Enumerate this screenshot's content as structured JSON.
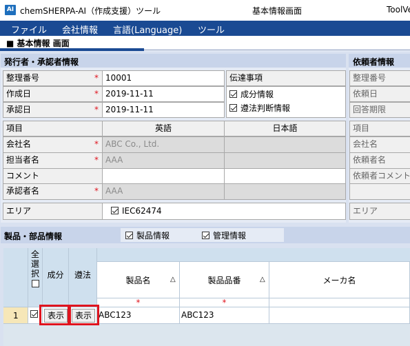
{
  "titlebar": {
    "app_icon": "AI",
    "app_title": "chemSHERPA-AI（作成支援）ツール",
    "window_center": "基本情報画面",
    "window_right": "ToolVe"
  },
  "menu": [
    "ファイル",
    "会社情報",
    "言語(Language)",
    "ツール"
  ],
  "page_header": "■ 基本情報 画面",
  "issuer": {
    "section_title": "発行者・承認者情報",
    "rows": [
      {
        "label": "整理番号",
        "value": "10001"
      },
      {
        "label": "作成日",
        "value": "2019-11-11"
      },
      {
        "label": "承認日",
        "value": "2019-11-11"
      }
    ],
    "required_mark": "*",
    "transmit": {
      "title": "伝達事項",
      "items": [
        {
          "label": "成分情報",
          "checked": true
        },
        {
          "label": "遵法判断情報",
          "checked": true
        }
      ]
    },
    "table_headers": {
      "item": "項目",
      "english": "英語",
      "japanese": "日本語"
    },
    "table_rows": [
      {
        "label": "会社名",
        "required": true,
        "english": "ABC Co., Ltd.",
        "japanese": ""
      },
      {
        "label": "担当者名",
        "required": true,
        "english": "AAA",
        "japanese": ""
      },
      {
        "label": "コメント",
        "required": false,
        "english": "",
        "japanese": ""
      },
      {
        "label": "承認者名",
        "required": true,
        "english": "AAA",
        "japanese": ""
      }
    ],
    "area": {
      "label": "エリア",
      "option": "IEC62474",
      "checked": true
    }
  },
  "requester": {
    "section_title": "依頼者情報",
    "rows": [
      "整理番号",
      "依頼日",
      "回答期限"
    ],
    "table_rows": [
      "項目",
      "会社名",
      "依頼者名",
      "依頼者コメント"
    ],
    "area_label": "エリア"
  },
  "products": {
    "section_title": "製品・部品情報",
    "filters": [
      {
        "label": "製品情報",
        "checked": true
      },
      {
        "label": "管理情報",
        "checked": true
      }
    ],
    "columns": {
      "select_all": "全\n選\n択",
      "component": "成分",
      "compliance": "遵法",
      "product_name": "製品名",
      "product_number": "製品品番",
      "maker_name": "メーカ名"
    },
    "sort_glyph": "△",
    "rows": [
      {
        "index": "1",
        "checked": true,
        "btn1": "表示",
        "btn2": "表示",
        "product_name": "ABC123",
        "product_number": "ABC123",
        "maker_name": ""
      }
    ]
  },
  "colors": {
    "menu_bg": "#1a4a93",
    "highlight": "#e0141e",
    "content_bg": "#d9e1f0"
  }
}
